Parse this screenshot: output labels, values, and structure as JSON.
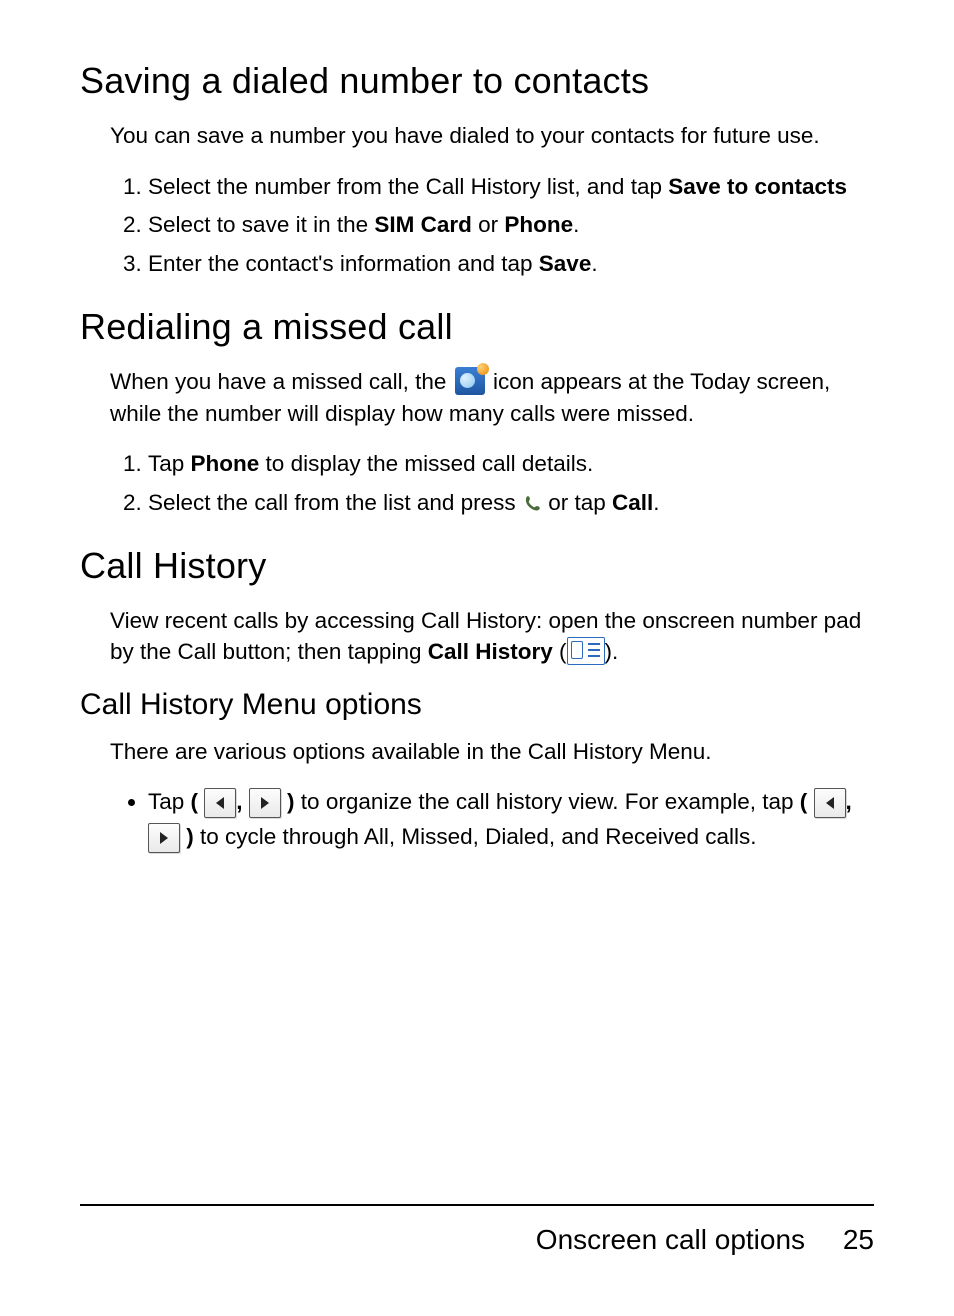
{
  "sections": {
    "saving": {
      "heading": "Saving a dialed number to contacts",
      "intro": "You can save a number you have dialed to your contacts for future use.",
      "steps": {
        "s1a": "Select the number from the Call History list, and tap ",
        "s1b": "Save to contacts",
        "s2a": "Select to save it in the ",
        "s2b": "SIM Card",
        "s2c": " or ",
        "s2d": "Phone",
        "s2e": ".",
        "s3a": "Enter the contact's information and tap ",
        "s3b": "Save",
        "s3c": "."
      }
    },
    "redial": {
      "heading": "Redialing a missed call",
      "intro_a": "When you have a missed call, the ",
      "intro_b": " icon appears at the Today screen, while the number will display how many calls were missed.",
      "steps": {
        "s1a": "Tap ",
        "s1b": "Phone",
        "s1c": " to display the missed call details.",
        "s2a": "Select the call from the list and press ",
        "s2b": " or tap ",
        "s2c": "Call",
        "s2d": "."
      }
    },
    "history": {
      "heading": "Call History",
      "intro_a": "View recent calls by accessing Call History: open the onscreen number pad by the Call button; then tapping ",
      "intro_b": "Call History",
      "intro_paren_open": " (",
      "intro_paren_close": ").",
      "sub_heading": "Call History Menu options",
      "sub_intro": "There are various options available in the Call History Menu.",
      "bullet": {
        "b1a": "Tap ",
        "paren_open": "( ",
        "comma": ", ",
        "paren_close": " )",
        "b1b": " to organize the call history view. For example, tap ",
        "b1c": " to cycle through All, Missed, Dialed, and Received calls."
      }
    }
  },
  "footer": {
    "title": "Onscreen call options",
    "page_number": "25"
  },
  "icons": {
    "missed_call": "missed-call-icon",
    "phone_small": "phone-small-icon",
    "call_history_list": "call-history-list-icon",
    "nav_left": "nav-left-icon",
    "nav_right": "nav-right-icon"
  }
}
